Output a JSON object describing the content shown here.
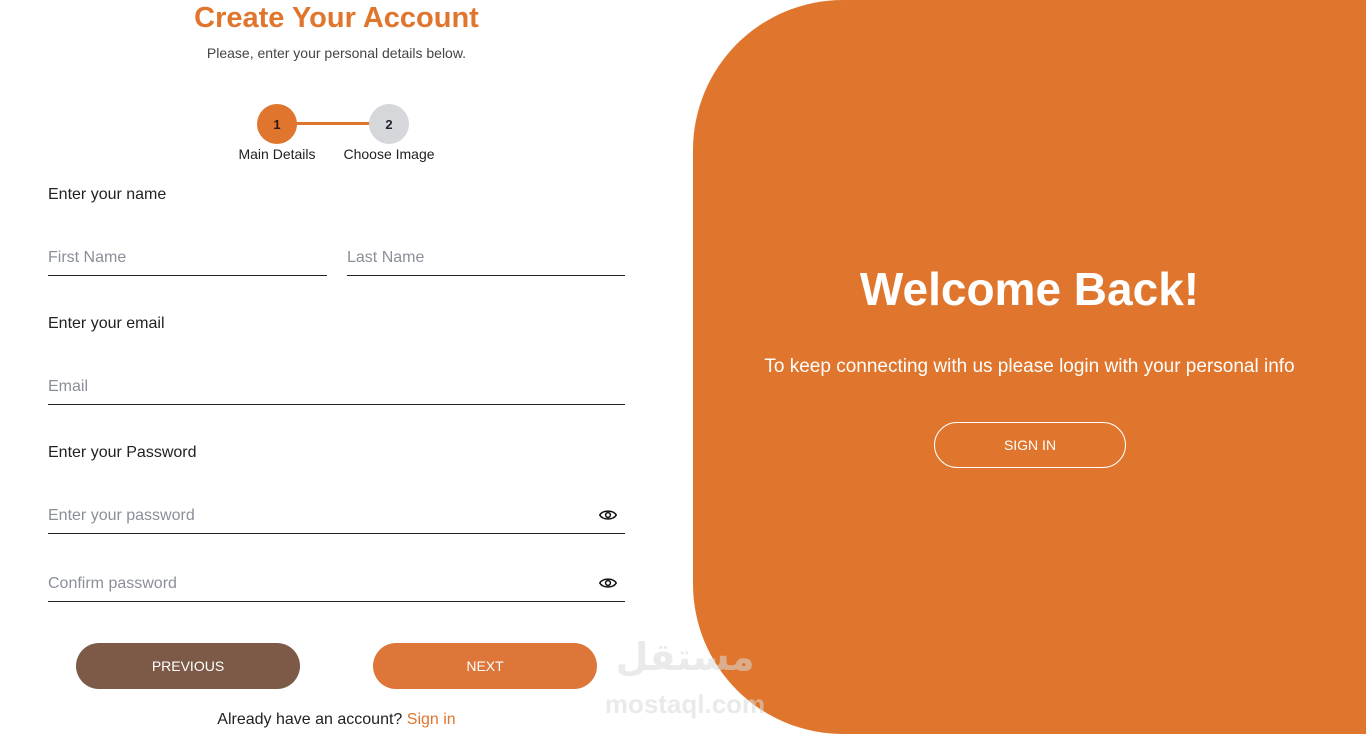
{
  "form": {
    "title": "Create Your Account",
    "subtitle": "Please, enter your personal details below.",
    "steps": [
      {
        "number": "1",
        "label": "Main Details",
        "status": "active"
      },
      {
        "number": "2",
        "label": "Choose Image",
        "status": "inactive"
      }
    ],
    "name_section_label": "Enter your name",
    "first_name_placeholder": "First Name",
    "first_name_value": "",
    "last_name_placeholder": "Last Name",
    "last_name_value": "",
    "email_section_label": "Enter your email",
    "email_placeholder": "Email",
    "email_value": "",
    "password_section_label": "Enter your Password",
    "password_placeholder": "Enter your password",
    "password_value": "",
    "confirm_placeholder": "Confirm password",
    "confirm_value": "",
    "previous_label": "PREVIOUS",
    "next_label": "NEXT",
    "footer_text": "Already have an account?",
    "footer_link": "Sign in"
  },
  "panel": {
    "heading": "Welcome Back!",
    "text": "To keep connecting with us please login with your personal info",
    "signin_label": "SIGN IN"
  },
  "watermark": {
    "arabic": "مستقل",
    "latin": "mostaql.com"
  },
  "icons": {
    "password_toggle": "eye-icon",
    "confirm_toggle": "eye-icon"
  },
  "colors": {
    "accent": "#e0762d",
    "previous_button": "#7d5a48",
    "next_button": "#dd7638",
    "step_inactive": "#d5d7db"
  }
}
